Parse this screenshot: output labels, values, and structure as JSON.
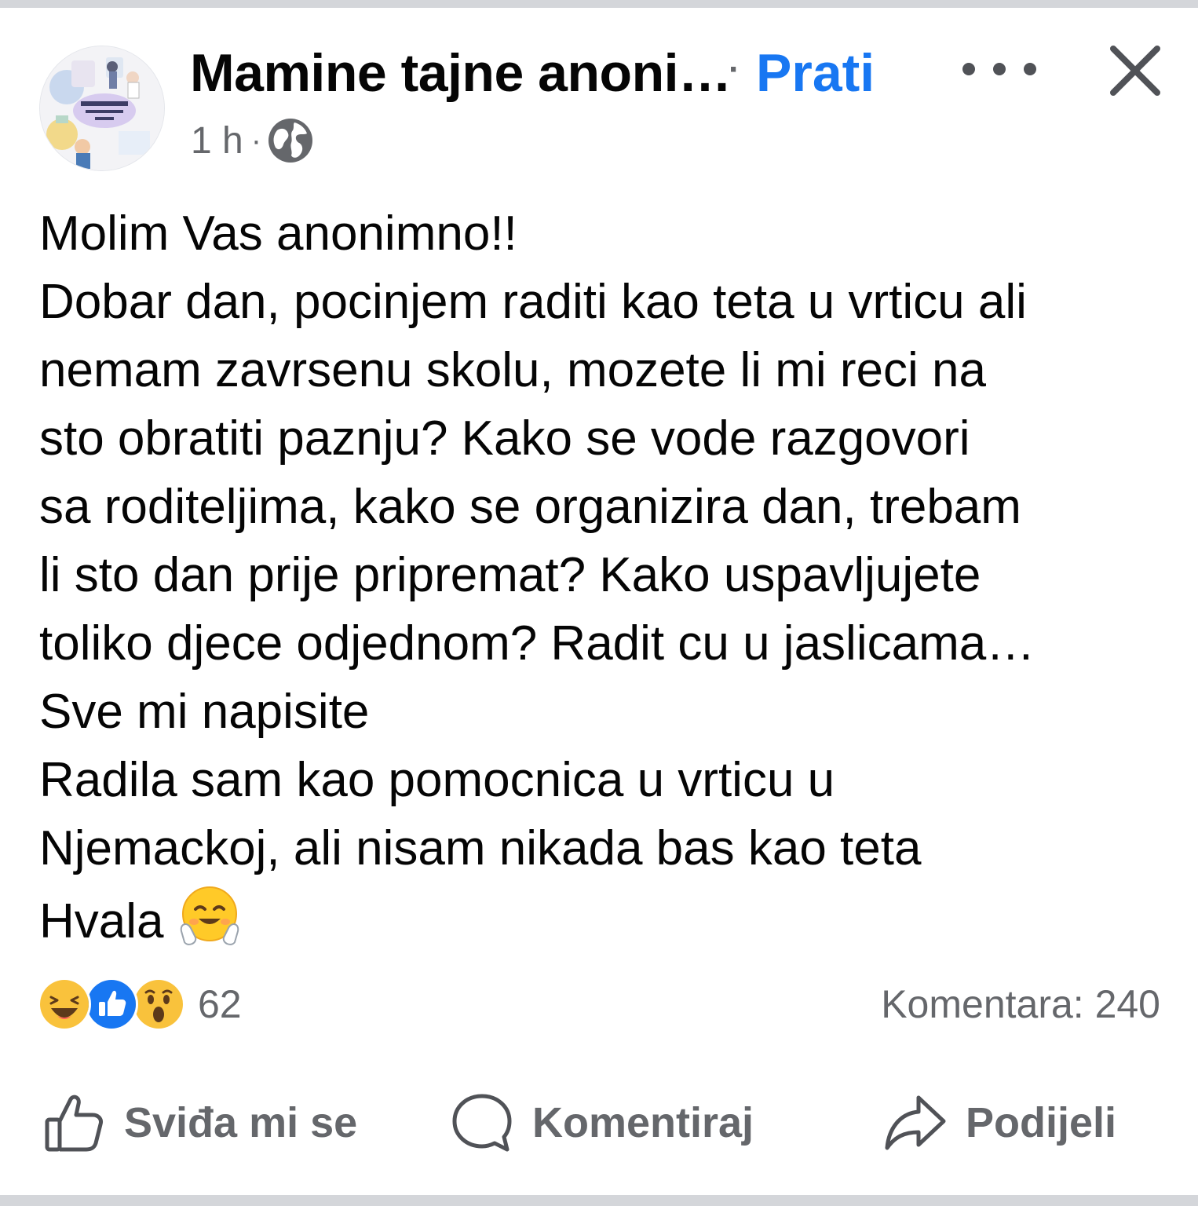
{
  "post": {
    "author": "Mamine tajne anoni…",
    "separator": "·",
    "follow_label": "Prati",
    "time": "1 h",
    "meta_separator": "·",
    "audience_icon": "globe-icon",
    "body_lines": [
      "Molim Vas anonimno!!",
      "Dobar dan, pocinjem raditi kao teta u vrticu ali",
      "nemam zavrsenu skolu, mozete li mi reci na",
      "sto obratiti paznju? Kako se vode razgovori",
      "sa roditeljima, kako se organizira dan, trebam",
      "li sto dan prije pripremat? Kako uspavljujete",
      "toliko djece odjednom? Radit cu u jaslicama…",
      "Sve mi napisite",
      "Radila sam kao pomocnica u vrticu u",
      "Njemackoj, ali nisam nikada bas kao teta",
      "Hvala"
    ],
    "closing_emoji": "hugging-face-emoji"
  },
  "reactions": {
    "icons": [
      "haha-reaction-icon",
      "like-reaction-icon",
      "wow-reaction-icon"
    ],
    "count": "62"
  },
  "comments": {
    "label": "Komentara: 240"
  },
  "actions": {
    "like_label": "Sviđa mi se",
    "comment_label": "Komentiraj",
    "share_label": "Podijeli"
  },
  "colors": {
    "accent": "#1877f2",
    "secondary_text": "#65676b",
    "primary_text": "#050505",
    "divider": "#d4d6da"
  }
}
